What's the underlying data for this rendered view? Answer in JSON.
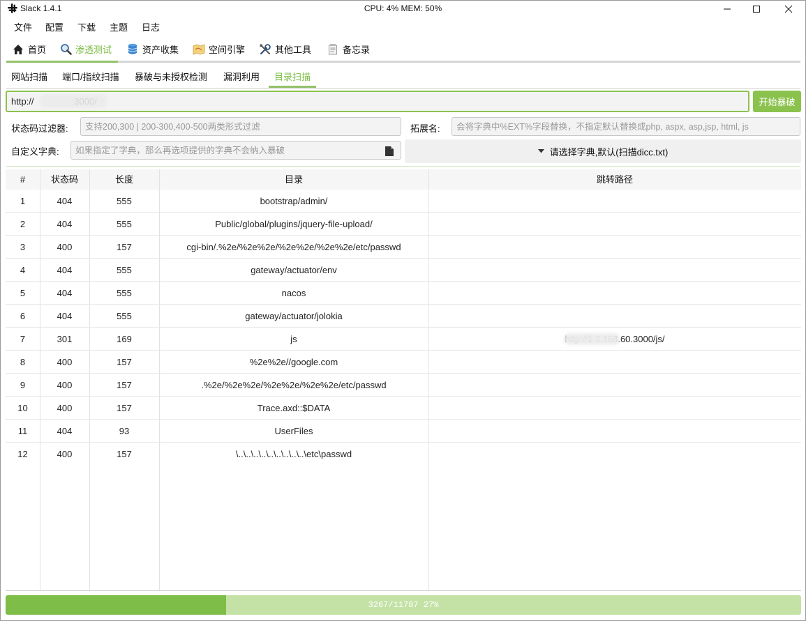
{
  "app": {
    "title": "Slack 1.4.1",
    "stats": "CPU: 4% MEM: 50%"
  },
  "menu": [
    "文件",
    "配置",
    "下载",
    "主题",
    "日志"
  ],
  "main_tabs": [
    {
      "label": "首页",
      "icon": "home-icon",
      "active": false
    },
    {
      "label": "渗透测试",
      "icon": "magnifier-icon",
      "active": true
    },
    {
      "label": "资产收集",
      "icon": "database-icon",
      "active": false
    },
    {
      "label": "空间引擎",
      "icon": "map-icon",
      "active": false
    },
    {
      "label": "其他工具",
      "icon": "tools-icon",
      "active": false
    },
    {
      "label": "备忘录",
      "icon": "memo-icon",
      "active": false
    }
  ],
  "sub_tabs": [
    {
      "label": "网站扫描",
      "active": false
    },
    {
      "label": "端口/指纹扫描",
      "active": false
    },
    {
      "label": "暴破与未授权检测",
      "active": false
    },
    {
      "label": "漏洞利用",
      "active": false
    },
    {
      "label": "目录扫描",
      "active": true
    }
  ],
  "scan": {
    "url_value": "http://               :3000/",
    "start_label": "开始暴破",
    "status_filter_label": "状态码过滤器:",
    "status_filter_placeholder": "支持200,300 | 200-300,400-500两类形式过滤",
    "ext_label": "拓展名:",
    "ext_placeholder": "会将字典中%EXT%字段替换，不指定默认替换成php, aspx, asp,jsp, html, js",
    "custom_dict_label": "自定义字典:",
    "custom_dict_placeholder": "如果指定了字典，那么再选项提供的字典不会纳入暴破",
    "dict_select_label": "请选择字典,默认(扫描dicc.txt)"
  },
  "table": {
    "headers": [
      "#",
      "状态码",
      "长度",
      "目录",
      "跳转路径"
    ],
    "rows": [
      {
        "n": "1",
        "code": "404",
        "len": "555",
        "dir": "bootstrap/admin/",
        "redirect": ""
      },
      {
        "n": "2",
        "code": "404",
        "len": "555",
        "dir": "Public/global/plugins/jquery-file-upload/",
        "redirect": ""
      },
      {
        "n": "3",
        "code": "400",
        "len": "157",
        "dir": "cgi-bin/.%2e/%2e%2e/%2e%2e/%2e%2e/etc/passwd",
        "redirect": ""
      },
      {
        "n": "4",
        "code": "404",
        "len": "555",
        "dir": "gateway/actuator/env",
        "redirect": ""
      },
      {
        "n": "5",
        "code": "404",
        "len": "555",
        "dir": "nacos",
        "redirect": ""
      },
      {
        "n": "6",
        "code": "404",
        "len": "555",
        "dir": "gateway/actuator/jolokia",
        "redirect": ""
      },
      {
        "n": "7",
        "code": "301",
        "len": "169",
        "dir": "js",
        "redirect": "http://1            3.168.60.3000/js/"
      },
      {
        "n": "8",
        "code": "400",
        "len": "157",
        "dir": "%2e%2e//google.com",
        "redirect": ""
      },
      {
        "n": "9",
        "code": "400",
        "len": "157",
        "dir": ".%2e/%2e%2e/%2e%2e/%2e%2e/etc/passwd",
        "redirect": ""
      },
      {
        "n": "10",
        "code": "400",
        "len": "157",
        "dir": "Trace.axd::$DATA",
        "redirect": ""
      },
      {
        "n": "11",
        "code": "404",
        "len": "93",
        "dir": "UserFiles",
        "redirect": ""
      },
      {
        "n": "12",
        "code": "400",
        "len": "157",
        "dir": "\\..\\..\\..\\..\\..\\..\\..\\..\\..\\etc\\passwd",
        "redirect": ""
      }
    ]
  },
  "progress": {
    "text": "3267/11787  27%",
    "fraction": 0.277
  },
  "colors": {
    "accent": "#7cbd44",
    "button": "#8bc24e",
    "progress_bg": "#c5e2a6",
    "progress_fill": "#7dbd48"
  }
}
